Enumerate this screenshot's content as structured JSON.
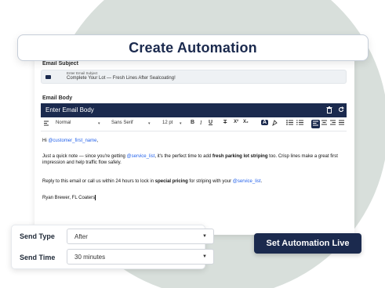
{
  "header": {
    "title": "Create Automation"
  },
  "subject": {
    "label": "Email Subject",
    "placeholder": "Enter Email Subject",
    "value": "Complete Your Lot — Fresh Lines After Sealcoating!"
  },
  "body": {
    "label": "Email Body",
    "editor_title": "Enter Email Body",
    "toolbar": {
      "style": "Normal",
      "font": "Sans Serif",
      "size": "12 pt"
    },
    "greeting": {
      "prefix": "Hi ",
      "mention": "@customer_first_name",
      "suffix": ","
    },
    "para1": {
      "a": "Just a quick note — since you're getting ",
      "mention": "@service_list",
      "b": ", it's the perfect time to add ",
      "bold": "fresh parking lot striping",
      "c": " too. Crisp lines make a great first impression and help traffic flow safely."
    },
    "para2": {
      "a": "Reply to this email or call us within 24 hours to lock in ",
      "bold": "special pricing",
      "b": " for striping with your ",
      "mention": "@service_list",
      "c": "."
    },
    "signature": "Ryan Brewer, FL Coaters"
  },
  "send": {
    "type_label": "Send Type",
    "type_value": "After",
    "time_label": "Send Time",
    "time_value": "30 minutes"
  },
  "actions": {
    "live_button": "Set Automation Live"
  },
  "colors": {
    "navy": "#1b2a4e",
    "mention": "#2563eb",
    "circle": "#d8dfdb"
  }
}
